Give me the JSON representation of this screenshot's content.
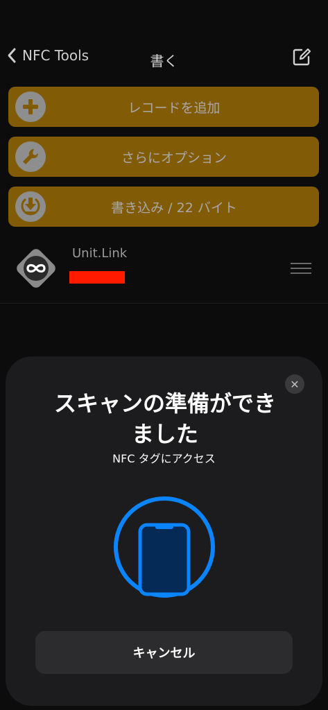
{
  "nav": {
    "back_label": "NFC Tools",
    "title": "書く"
  },
  "actions": [
    {
      "label": "レコードを追加",
      "icon": "plus-circle-icon"
    },
    {
      "label": "さらにオプション",
      "icon": "wrench-icon"
    },
    {
      "label": "書き込み / 22 バイト",
      "icon": "download-icon"
    }
  ],
  "record": {
    "title": "Unit.Link",
    "icon": "infinity-icon"
  },
  "sheet": {
    "title": "スキャンの準備ができました",
    "subtitle": "NFC タグにアクセス",
    "cancel_label": "キャンセル"
  },
  "colors": {
    "background": "#0c0c0c",
    "action_bg": "#825b06",
    "sheet_bg": "#1c1c1e",
    "accent_blue": "#0a84ff",
    "redaction": "#ff1a00"
  }
}
